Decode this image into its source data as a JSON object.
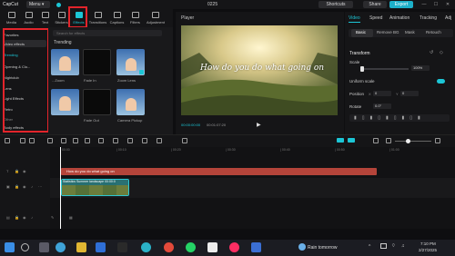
{
  "titlebar": {
    "app_name": "CapCut",
    "menu_label": "Menu",
    "project_title": "0225",
    "shortcuts_label": "Shortcuts",
    "share_label": "Share",
    "export_label": "Export",
    "win_min": "—",
    "win_max": "☐",
    "win_close": "✕"
  },
  "toolbar": {
    "tabs": [
      {
        "label": "Media"
      },
      {
        "label": "Audio"
      },
      {
        "label": "Text"
      },
      {
        "label": "Stickers"
      },
      {
        "label": "Effects"
      },
      {
        "label": "Transitions"
      },
      {
        "label": "Captions"
      },
      {
        "label": "Filters"
      },
      {
        "label": "Adjustment"
      }
    ],
    "active": "Effects"
  },
  "left_categories": {
    "items": [
      {
        "label": "Favorites"
      },
      {
        "label": "Video effects"
      },
      {
        "label": "Trending"
      },
      {
        "label": "Opening & Clo..."
      },
      {
        "label": "Nightclub"
      },
      {
        "label": "Lens"
      },
      {
        "label": "Light Effects"
      },
      {
        "label": "Retro"
      },
      {
        "label": "Other"
      },
      {
        "label": "Body effects"
      }
    ],
    "selected": "Trending"
  },
  "media": {
    "search_placeholder": "Search for effects",
    "section_title": "Trending",
    "thumbs": [
      {
        "label": "...Zoom",
        "color": "#6a8fb8"
      },
      {
        "label": "Fade In",
        "color": "#0a0a0a"
      },
      {
        "label": "Zoom Lens",
        "color": "#4a7aa8"
      },
      {
        "label": "",
        "color": "#4f7ab0"
      },
      {
        "label": "Fade Out",
        "color": "#0a0a0a"
      },
      {
        "label": "Camera Pickup",
        "color": "#4a7aa8"
      }
    ]
  },
  "player": {
    "label": "Player",
    "caption": "How do you do what going on",
    "time_current": "00:00:00:00",
    "time_total": "00:01:07:20"
  },
  "right_panel": {
    "tabs": [
      {
        "label": "Video"
      },
      {
        "label": "Speed"
      },
      {
        "label": "Animation"
      },
      {
        "label": "Tracking"
      },
      {
        "label": "Adj"
      }
    ],
    "active_tab": "Video",
    "subtabs": [
      {
        "label": "Basic"
      },
      {
        "label": "Remove BG"
      },
      {
        "label": "Mask"
      },
      {
        "label": "Retouch"
      }
    ],
    "transform_title": "Transform",
    "scale_label": "Scale",
    "scale_value": "100%",
    "uniform_scale_label": "Uniform scale",
    "position_label": "Position",
    "position_x": "0",
    "position_y": "0",
    "rotate_label": "Rotate",
    "rotate_value": "0.0°"
  },
  "timeline": {
    "ruler_marks": [
      "00:00",
      "| 00:10",
      "| 00:20",
      "| 00:30",
      "| 00:40",
      "| 00:50",
      "| 01:00"
    ],
    "text_clip_label": "How do you do what going on",
    "video_clip_label": "Statistics   Summer landscape  00:00:0"
  },
  "taskbar": {
    "weather": "Rain tomorrow",
    "time": "7:10 PM",
    "date": "2/27/2025"
  },
  "colors": {
    "accent": "#1cc6d6",
    "highlight": "#e3242b",
    "text_clip": "#b4443a"
  }
}
